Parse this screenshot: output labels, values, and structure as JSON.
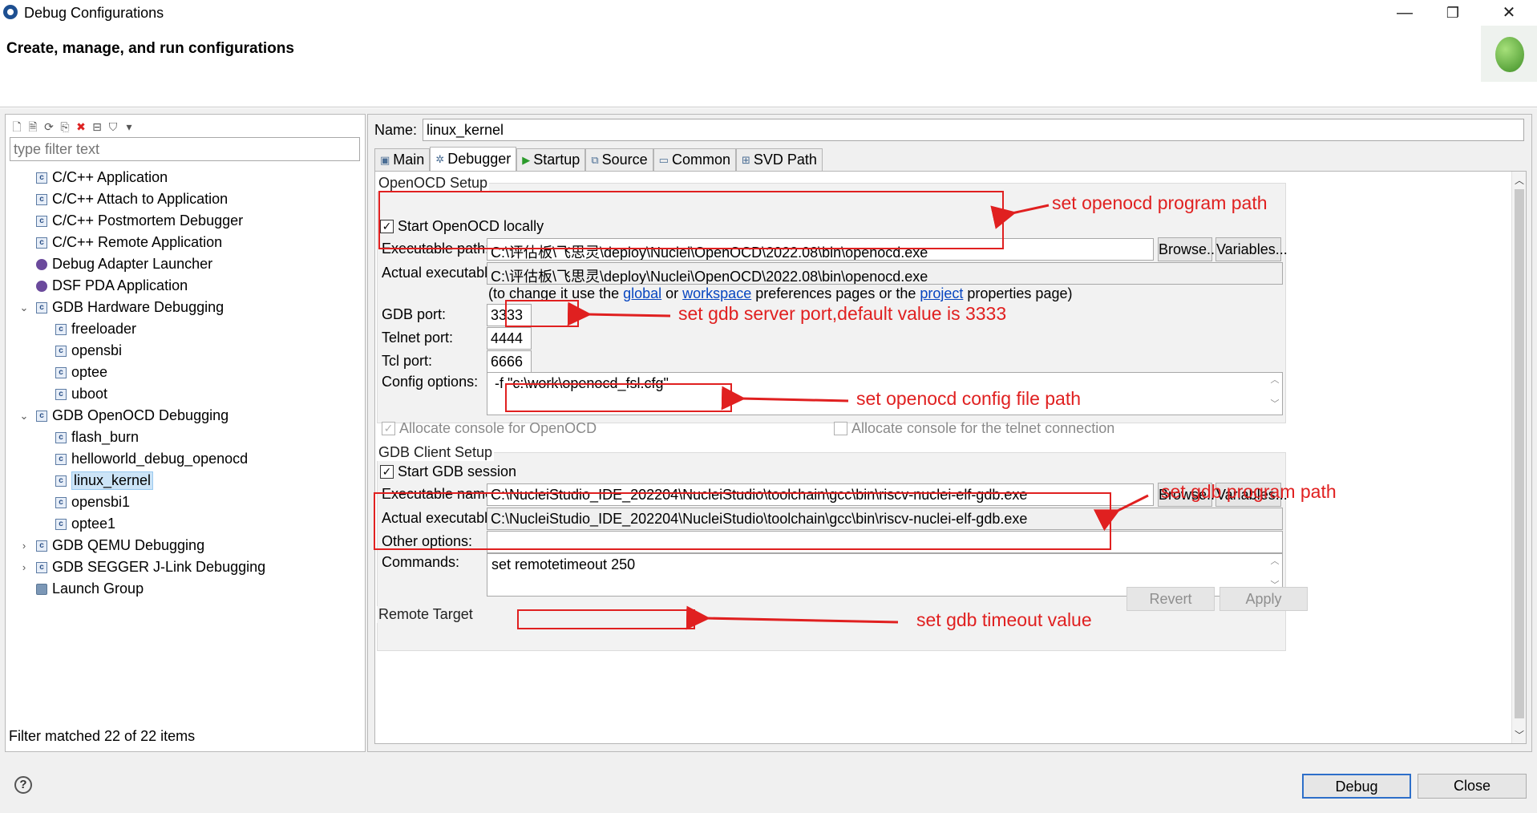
{
  "window": {
    "title": "Debug Configurations",
    "minimize": "—",
    "restore": "❐",
    "close": "✕"
  },
  "header": {
    "text": "Create, manage, and run configurations"
  },
  "left": {
    "filter_placeholder": "type filter text",
    "status": "Filter matched 22 of 22 items",
    "tree": [
      {
        "label": "C/C++ Application",
        "icon": "c-config-icon"
      },
      {
        "label": "C/C++ Attach to Application",
        "icon": "c-config-icon"
      },
      {
        "label": "C/C++ Postmortem Debugger",
        "icon": "c-config-icon"
      },
      {
        "label": "C/C++ Remote Application",
        "icon": "c-config-icon"
      },
      {
        "label": "Debug Adapter Launcher",
        "icon": "debug-adapter-icon"
      },
      {
        "label": "DSF PDA Application",
        "icon": "dsf-pda-icon"
      },
      {
        "label": "GDB Hardware Debugging",
        "icon": "c-config-icon",
        "expanded": true
      },
      {
        "label": "freeloader",
        "icon": "c-config-icon"
      },
      {
        "label": "opensbi",
        "icon": "c-config-icon"
      },
      {
        "label": "optee",
        "icon": "c-config-icon"
      },
      {
        "label": "uboot",
        "icon": "c-config-icon"
      },
      {
        "label": "GDB OpenOCD Debugging",
        "icon": "c-config-icon",
        "expanded": true
      },
      {
        "label": "flash_burn",
        "icon": "c-config-icon"
      },
      {
        "label": "helloworld_debug_openocd",
        "icon": "c-config-icon"
      },
      {
        "label": "linux_kernel",
        "icon": "c-config-icon",
        "selected": true
      },
      {
        "label": "opensbi1",
        "icon": "c-config-icon"
      },
      {
        "label": "optee1",
        "icon": "c-config-icon"
      },
      {
        "label": "GDB QEMU Debugging",
        "icon": "c-config-icon",
        "expanded": false
      },
      {
        "label": "GDB SEGGER J-Link Debugging",
        "icon": "c-config-icon",
        "expanded": false
      },
      {
        "label": "Launch Group",
        "icon": "launch-group-icon"
      }
    ]
  },
  "right": {
    "name_label": "Name:",
    "name_value": "linux_kernel",
    "tabs": [
      {
        "label": "Main",
        "icon": "main-tab-icon"
      },
      {
        "label": "Debugger",
        "icon": "debugger-tab-icon",
        "active": true
      },
      {
        "label": "Startup",
        "icon": "startup-tab-icon"
      },
      {
        "label": "Source",
        "icon": "source-tab-icon"
      },
      {
        "label": "Common",
        "icon": "common-tab-icon"
      },
      {
        "label": "SVD Path",
        "icon": "svd-tab-icon"
      }
    ],
    "openocd": {
      "group_title": "OpenOCD Setup",
      "start_locally_label": "Start OpenOCD locally",
      "start_locally_checked": true,
      "exe_label": "Executable path:",
      "exe_value": "C:\\评估板\\飞思灵\\deploy\\Nuclei\\OpenOCD\\2022.08\\bin\\openocd.exe",
      "browse": "Browse...",
      "variables": "Variables...",
      "actual_label": "Actual executable:",
      "actual_value": "C:\\评估板\\飞思灵\\deploy\\Nuclei\\OpenOCD\\2022.08\\bin\\openocd.exe",
      "hint_prefix": "(to change it use the ",
      "hint_global": "global",
      "hint_or": " or ",
      "hint_workspace": "workspace",
      "hint_mid": " preferences pages or the ",
      "hint_project": "project",
      "hint_suffix": " properties page)",
      "gdb_port_label": "GDB port:",
      "gdb_port_value": "3333",
      "telnet_port_label": "Telnet port:",
      "telnet_port_value": "4444",
      "tcl_port_label": "Tcl port:",
      "tcl_port_value": "6666",
      "config_label": "Config options:",
      "config_value": "-f \"c:\\work\\openocd_fsl.cfg\"",
      "alloc_console_label": "Allocate console for OpenOCD",
      "alloc_console_checked": true,
      "alloc_telnet_label": "Allocate console for the telnet connection",
      "alloc_telnet_checked": false
    },
    "gdb": {
      "group_title": "GDB Client Setup",
      "start_session_label": "Start GDB session",
      "start_session_checked": true,
      "exe_label": "Executable name:",
      "exe_value": "C:\\NucleiStudio_IDE_202204\\NucleiStudio\\toolchain\\gcc\\bin\\riscv-nuclei-elf-gdb.exe",
      "browse": "Browse...",
      "variables": "Variables...",
      "actual_label": "Actual executable:",
      "actual_value": "C:\\NucleiStudio_IDE_202204\\NucleiStudio\\toolchain\\gcc\\bin\\riscv-nuclei-elf-gdb.exe",
      "other_label": "Other options:",
      "other_value": "",
      "commands_label": "Commands:",
      "commands_value": "set remotetimeout 250"
    },
    "remote_target_title": "Remote Target",
    "revert": "Revert",
    "apply": "Apply"
  },
  "footer": {
    "debug": "Debug",
    "close": "Close",
    "help": "?"
  },
  "annotations": {
    "openocd_path": "set openocd program path",
    "gdb_port": "set gdb server port,default value is 3333",
    "config_file": "set openocd config file path",
    "gdb_path": "set gdb program path",
    "timeout": "set gdb timeout value",
    "color": "#e02020"
  }
}
